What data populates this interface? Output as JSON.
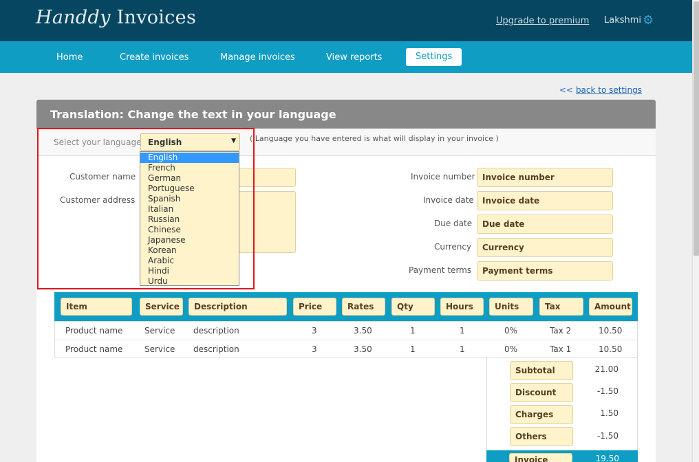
{
  "header": {
    "logo_script": "Handdy",
    "logo_rest": "Invoices",
    "upgrade_link": "Upgrade to premium",
    "user_name": "Lakshmi"
  },
  "nav": {
    "items": [
      "Home",
      "Create invoices",
      "Manage invoices",
      "View reports",
      "Settings"
    ],
    "active": "Settings"
  },
  "back_link": {
    "arrows": "<<",
    "label": "back to settings"
  },
  "panel": {
    "title": "Translation: Change the text in your language",
    "language_label": "Select your language",
    "language_selected": "English",
    "language_note": "( Language you have entered is what will display in your invoice )",
    "language_options": [
      "English",
      "French",
      "German",
      "Portuguese",
      "Spanish",
      "Italian",
      "Russian",
      "Chinese",
      "Japanese",
      "Korean",
      "Arabic",
      "Hindi",
      "Urdu"
    ]
  },
  "customer": {
    "name_label": "Customer name",
    "address_label": "Customer address"
  },
  "invoice_fields": [
    {
      "label": "Invoice number",
      "value": "Invoice number"
    },
    {
      "label": "Invoice date",
      "value": "Invoice date"
    },
    {
      "label": "Due date",
      "value": "Due date"
    },
    {
      "label": "Currency",
      "value": "Currency"
    },
    {
      "label": "Payment terms",
      "value": "Payment terms"
    }
  ],
  "table": {
    "headers": [
      "Item",
      "Service",
      "Description",
      "Price",
      "Rates",
      "Qty",
      "Hours",
      "Units",
      "Tax",
      "Amount"
    ],
    "rows": [
      [
        "Product name",
        "Service",
        "description",
        "3",
        "3.50",
        "1",
        "1",
        "0%",
        "Tax 2",
        "10.50"
      ],
      [
        "Product name",
        "Service",
        "description",
        "3",
        "3.50",
        "1",
        "1",
        "0%",
        "Tax 1",
        "10.50"
      ]
    ]
  },
  "totals": [
    {
      "label": "Subtotal",
      "value": "21.00"
    },
    {
      "label": "Discount",
      "value": "-1.50"
    },
    {
      "label": "Charges",
      "value": "1.50"
    },
    {
      "label": "Others",
      "value": "-1.50"
    }
  ],
  "grand_total": {
    "label": "Invoice total",
    "value": "19.50"
  },
  "colors": {
    "header_bg": "#064660",
    "nav_bg": "#0f9dc4",
    "field_bg": "#fff3cc",
    "highlight_border": "#e0161c",
    "selected_option": "#3399ff"
  }
}
